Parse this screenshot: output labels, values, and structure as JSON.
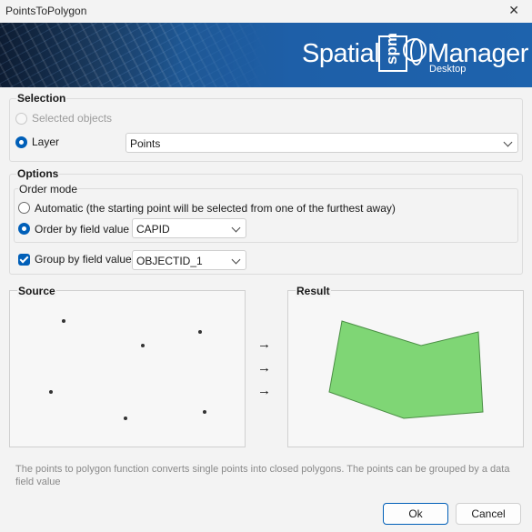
{
  "window": {
    "title": "PointsToPolygon",
    "close_glyph": "✕"
  },
  "banner": {
    "word1": "Spatial",
    "box_text": "spm",
    "word2": "Manager",
    "word3": "Desktop"
  },
  "selection": {
    "header": "Selection",
    "selected_objects_label": "Selected objects",
    "layer_label": "Layer",
    "layer_value": "Points"
  },
  "options": {
    "header": "Options",
    "order_mode_label": "Order mode",
    "automatic_label": "Automatic (the starting point will be selected from one of the furthest away)",
    "order_by_field_label": "Order by field value",
    "order_field_value": "CAPID",
    "group_by_field_label": "Group by field value",
    "group_field_value": "OBJECTID_1"
  },
  "preview": {
    "source_label": "Source",
    "result_label": "Result",
    "arrow_glyph": "→",
    "polygon_fill": "#7fd675",
    "polygon_stroke": "#4b8f45",
    "point_color": "#333333"
  },
  "description": "The points to polygon function converts single points into closed polygons. The points can be grouped by a data field value",
  "buttons": {
    "ok": "Ok",
    "cancel": "Cancel"
  }
}
